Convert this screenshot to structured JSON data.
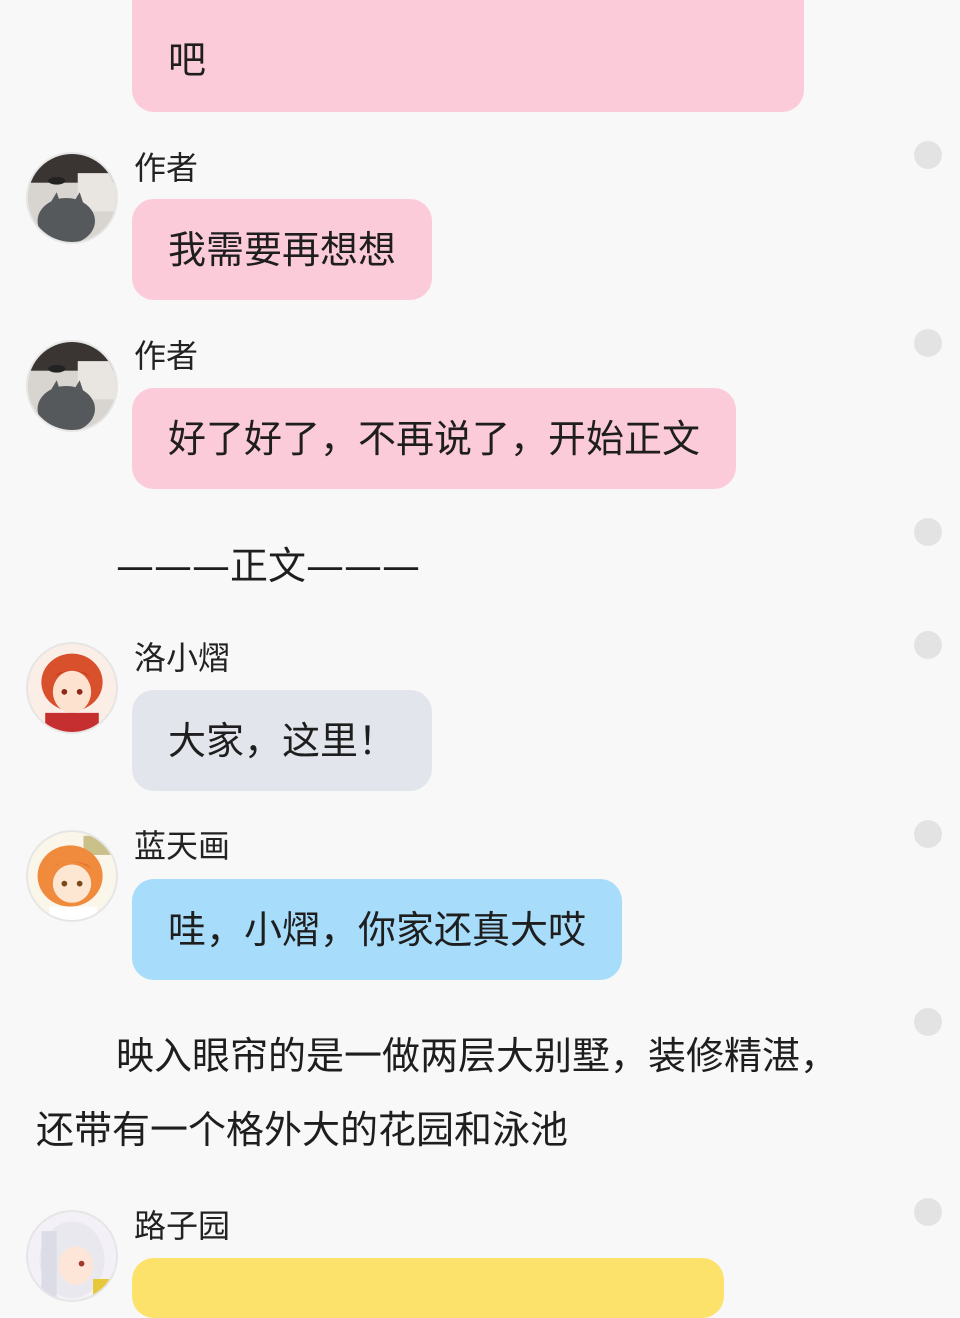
{
  "messages": {
    "top_partial": {
      "line2": "吧"
    },
    "m1": {
      "sender": "作者",
      "text": "我需要再想想",
      "avatar": "author-avatar"
    },
    "m2": {
      "sender": "作者",
      "text": "好了好了，不再说了，开始正文",
      "avatar": "author-avatar"
    },
    "divider": "———正文———",
    "m3": {
      "sender": "洛小熠",
      "text": "大家，这里！",
      "avatar": "red-hair-avatar"
    },
    "m4": {
      "sender": "蓝天画",
      "text": "哇，小熠，你家还真大哎",
      "avatar": "orange-hair-avatar"
    },
    "narration": {
      "line1": "映入眼帘的是一做两层大别墅，装修精湛，",
      "line2": "还带有一个格外大的花园和泳池"
    },
    "m5": {
      "sender": "路子园",
      "text": "",
      "avatar": "white-hair-avatar"
    }
  },
  "colors": {
    "pink": "#fccbd9",
    "grey": "#e2e5ec",
    "blue": "#a7dcfb",
    "yellow": "#fce26b"
  }
}
